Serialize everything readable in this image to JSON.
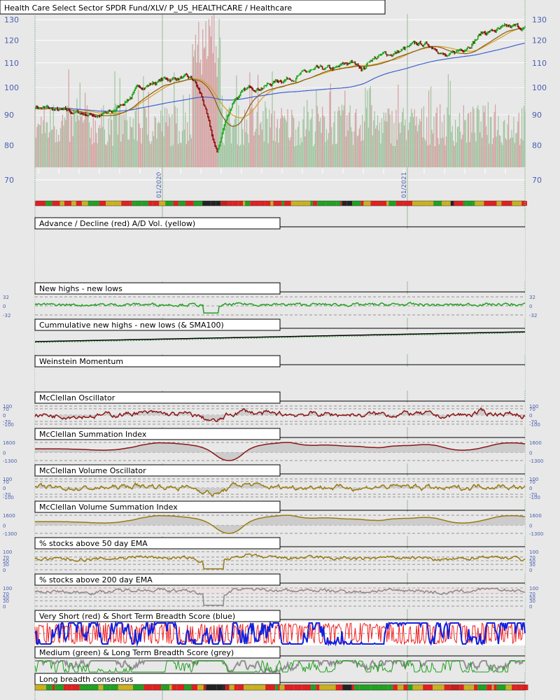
{
  "main": {
    "title": "Health Care Select Sector SPDR Fund/XLV/ P_US_HEALTHCARE / Healthcare",
    "price_ticks": [
      130,
      120,
      110,
      100,
      90,
      80,
      70
    ],
    "date_labels": [
      "01/2020",
      "01/2021"
    ],
    "colors": {
      "up": "#22aa22",
      "down": "#8b1010",
      "sma_short": "#d4a020",
      "sma_long": "#4060d0",
      "sma_mid": "#8b5a10",
      "vol_up": "#9fc49f",
      "vol_down": "#d4a0a0"
    }
  },
  "panels": [
    {
      "id": "advance-decline",
      "title": "Advance / Decline (red) A/D Vol. (yellow)",
      "labels": []
    },
    {
      "id": "new-highs-lows",
      "title": "New highs - new lows",
      "labels": [
        "32",
        "0",
        "-32"
      ],
      "values": [
        32,
        0,
        -32
      ]
    },
    {
      "id": "cumulative-new-highs-lows",
      "title": "Cummulative new highs - new lows (& SMA100)",
      "labels": [],
      "values": []
    },
    {
      "id": "weinstein-momentum",
      "title": "Weinstein Momentum",
      "labels": [],
      "values": []
    },
    {
      "id": "mcclellan-oscillator",
      "title": "McClellan Oscillator",
      "labels": [
        "100",
        "70",
        "0",
        "-70",
        "-100"
      ],
      "values": [
        100,
        70,
        0,
        -70,
        -100
      ]
    },
    {
      "id": "mcclellan-summation",
      "title": "McClellan Summation Index",
      "labels": [
        "1600",
        "0",
        "-1300"
      ],
      "values": [
        1600,
        0,
        -1300
      ]
    },
    {
      "id": "mcclellan-volume-oscillator",
      "title": "McClellan Volume Oscillator",
      "labels": [
        "100",
        "70",
        "0",
        "-70",
        "-100"
      ],
      "values": [
        100,
        70,
        0,
        -70,
        -100
      ]
    },
    {
      "id": "mcclellan-volume-summation",
      "title": "McClellan Volume Summation Index",
      "labels": [
        "1600",
        "0",
        "-1300"
      ],
      "values": [
        1600,
        0,
        -1300
      ]
    },
    {
      "id": "pct-above-50ema",
      "title": "% stocks above 50 day EMA",
      "labels": [
        "100",
        "70",
        "50",
        "30",
        "0"
      ],
      "values": [
        100,
        70,
        50,
        30,
        0
      ]
    },
    {
      "id": "pct-above-200ema",
      "title": "% stocks above 200 day EMA",
      "labels": [
        "100",
        "70",
        "50",
        "30",
        "0"
      ],
      "values": [
        100,
        70,
        50,
        30,
        0
      ]
    },
    {
      "id": "short-breadth-score",
      "title": "Very Short (red) & Short Term Breadth Score (blue)",
      "labels": [],
      "values": []
    },
    {
      "id": "medium-long-breadth-score",
      "title": "Medium (green) & Long Term Breadth Score (grey)",
      "labels": [],
      "values": []
    },
    {
      "id": "long-breadth-consensus",
      "title": "Long breadth consensus",
      "labels": [],
      "values": []
    }
  ]
}
